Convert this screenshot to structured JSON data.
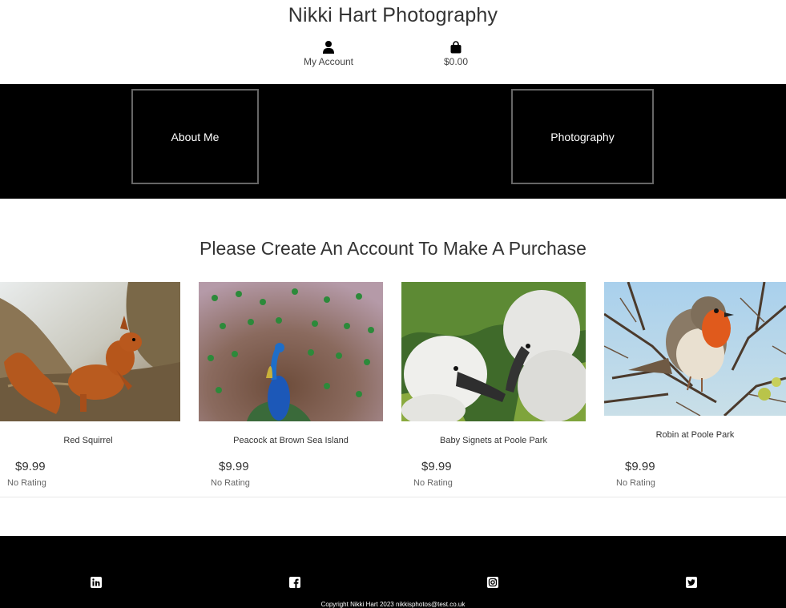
{
  "header": {
    "title": "Nikki Hart Photography",
    "account_label": "My Account",
    "bag_total": "$0.00"
  },
  "nav": {
    "about_label": "About Me",
    "photography_label": "Photography"
  },
  "main": {
    "heading": "Please Create An Account To Make A Purchase",
    "products": [
      {
        "name": "Red Squirrel",
        "price": "$9.99",
        "rating": "No Rating",
        "image": "red-squirrel-photo"
      },
      {
        "name": "Peacock at Brown Sea Island",
        "price": "$9.99",
        "rating": "No Rating",
        "image": "peacock-photo"
      },
      {
        "name": "Baby Signets at Poole Park",
        "price": "$9.99",
        "rating": "No Rating",
        "image": "baby-signets-photo"
      },
      {
        "name": "Robin at Poole Park",
        "price": "$9.99",
        "rating": "No Rating",
        "image": "robin-photo"
      }
    ]
  },
  "footer": {
    "social": [
      "linkedin-icon",
      "facebook-icon",
      "instagram-icon",
      "twitter-icon"
    ],
    "copyright": "Copyright Nikki Hart 2023 nikkisphotos@test.co.uk"
  },
  "colors": {
    "band": "#000000",
    "box_border": "#666666",
    "text": "#333333"
  }
}
